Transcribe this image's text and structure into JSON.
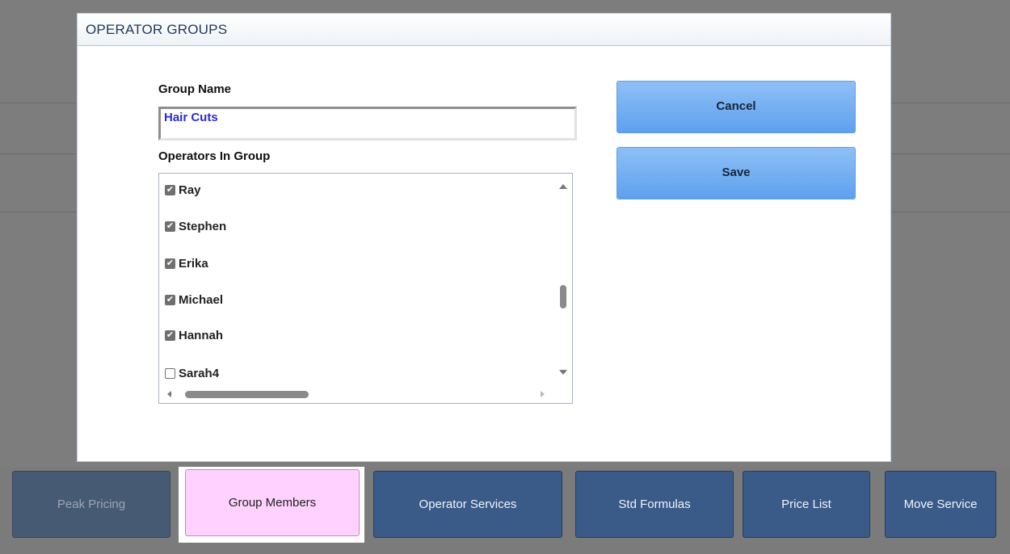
{
  "modal": {
    "title": "OPERATOR GROUPS",
    "group_name_label": "Group Name",
    "group_name_value": "Hair Cuts",
    "operators_label": "Operators In Group",
    "operators": [
      {
        "name": "Ray",
        "checked": true
      },
      {
        "name": "Stephen",
        "checked": true
      },
      {
        "name": "Erika",
        "checked": true
      },
      {
        "name": "Michael",
        "checked": true
      },
      {
        "name": "Hannah",
        "checked": true
      },
      {
        "name": "Sarah4",
        "checked": false
      }
    ],
    "cancel_label": "Cancel",
    "save_label": "Save"
  },
  "tabs": [
    {
      "label": "Peak Pricing",
      "state": "disabled"
    },
    {
      "label": "Group Members",
      "state": "active"
    },
    {
      "label": "Operator Services",
      "state": "normal"
    },
    {
      "label": "Std Formulas",
      "state": "normal"
    },
    {
      "label": "Price List",
      "state": "normal"
    },
    {
      "label": "Move Service",
      "state": "normal"
    }
  ],
  "colors": {
    "primary_button": "#6aaaf0",
    "active_tab": "#ffd1ff",
    "tab": "#3a5a87",
    "input_text": "#2b2bd9"
  }
}
